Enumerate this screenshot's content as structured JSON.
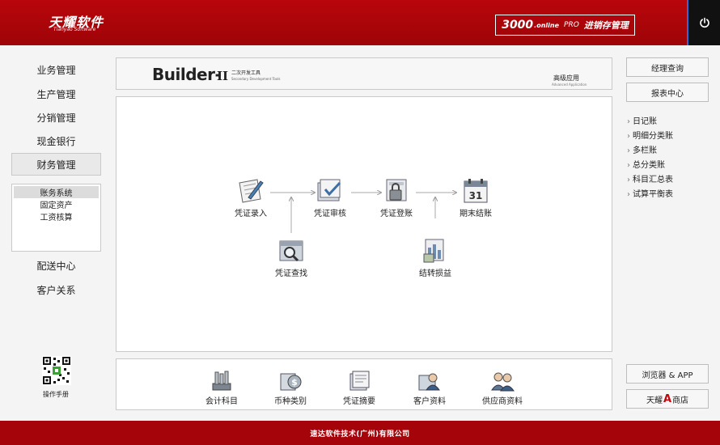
{
  "header": {
    "logo": "天耀软件",
    "logo_sub": "Tianyao Software",
    "product_num": "3000",
    "product_online": ".online",
    "product_pro": "PRO",
    "product_name": "进销存管理"
  },
  "nav": {
    "items": [
      "业务管理",
      "生产管理",
      "分销管理",
      "现金银行",
      "财务管理",
      "配送中心",
      "客户关系"
    ],
    "active": "财务管理",
    "subitems": [
      "账务系统",
      "固定资产",
      "工资核算"
    ],
    "subitem_selected": "账务系统",
    "manual_label": "操作手册"
  },
  "builder": {
    "title": "Builder-",
    "version": "II",
    "subtitle_cn": "二次开发工具",
    "subtitle_en": "Secondary Development Tools",
    "advanced": "高级应用",
    "advanced_en": "Advanced Application"
  },
  "flow": {
    "voucher_entry": "凭证录入",
    "voucher_audit": "凭证审核",
    "voucher_post": "凭证登账",
    "period_close": "期末结账",
    "voucher_search": "凭证查找",
    "transfer_pl": "结转损益",
    "calendar_day": "31"
  },
  "bottom": {
    "items": [
      "会计科目",
      "币种类别",
      "凭证摘要",
      "客户资料",
      "供应商资料"
    ]
  },
  "right": {
    "manager_query": "经理查询",
    "report_center": "报表中心",
    "links": [
      "日记账",
      "明细分类账",
      "多栏账",
      "总分类账",
      "科目汇总表",
      "试算平衡表"
    ],
    "browser_app": "浏览器 & APP",
    "store_prefix": "天耀",
    "store_a": "A",
    "store_suffix": "商店"
  },
  "footer": {
    "company": "速达软件技术(广州)有限公司"
  },
  "colors": {
    "brand_red": "#a5050a",
    "header_red": "#b8060b"
  }
}
